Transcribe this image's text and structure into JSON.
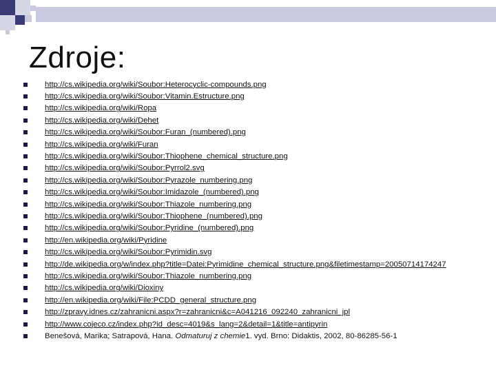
{
  "slide": {
    "title": "Zdroje:",
    "sources": [
      "http://cs.wikipedia.org/wiki/Soubor:Heterocyclic-compounds.png",
      "http://cs.wikipedia.org/wiki/Soubor:Vitamin.Estructure.png",
      "http://cs.wikipedia.org/wiki/Ropa",
      "http://cs.wikipedia.org/wiki/Dehet",
      "http://cs.wikipedia.org/wiki/Soubor:Furan_(numbered).png",
      "http://cs.wikipedia.org/wiki/Furan",
      "http://cs.wikipedia.org/wiki/Soubor:Thiophene_chemical_structure.png",
      "http://cs.wikipedia.org/wiki/Soubor:Pyrrol2.svg",
      "http://cs.wikipedia.org/wiki/Soubor:Pyrazole_numbering.png",
      "http://cs.wikipedia.org/wiki/Soubor:Imidazole_(numbered).png",
      "http://cs.wikipedia.org/wiki/Soubor:Thiazole_numbering.png",
      "http://cs.wikipedia.org/wiki/Soubor:Thiophene_(numbered).png",
      "http://cs.wikipedia.org/wiki/Soubor:Pyridine_(numbered).png",
      "http://en.wikipedia.org/wiki/Pyridine",
      "http://cs.wikipedia.org/wiki/Soubor:Pyrimidin.svg",
      "http://de.wikipedia.org/w/index.php?title=Datei:Pyrimidine_chemical_structure.png&filetimestamp=20050714174247",
      "http://cs.wikipedia.org/wiki/Soubor:Thiazole_numbering.png",
      "http://cs.wikipedia.org/wiki/Dioxiny",
      "http://en.wikipedia.org/wiki/File:PCDD_general_structure.png",
      "http://zpravy.idnes.cz/zahranicni.aspx?r=zahranicni&c=A041216_092240_zahranicni_jpl",
      "http://www.cojeco.cz/index.php?id_desc=4019&s_lang=2&detail=1&title=antipyrin"
    ],
    "book_reference": {
      "authors": "Benešová, Marika; Satrapová, Hana.",
      "title": "Odmaturuj z chemie",
      "details": "1. vyd. Brno: Didaktis, 2002, 80-86285-56-1"
    }
  },
  "colors": {
    "deco_dark": "#3b3b78",
    "deco_light": "#c9cadf",
    "bullet": "#1a1a4a"
  }
}
